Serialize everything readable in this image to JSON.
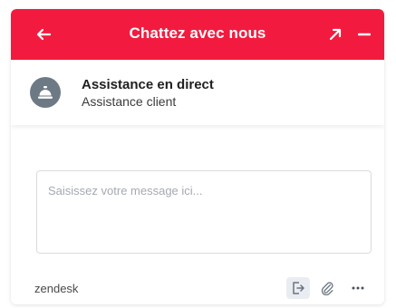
{
  "header": {
    "title": "Chattez avec nous",
    "back_icon": "arrow-left-icon",
    "popout_icon": "arrow-up-right-icon",
    "minimize_icon": "minus-icon",
    "background_color": "#f21b3f"
  },
  "agent": {
    "name": "Assistance en direct",
    "role": "Assistance client",
    "avatar_icon": "service-bell-icon"
  },
  "composer": {
    "placeholder": "Saisissez votre message ici...",
    "value": ""
  },
  "footer": {
    "brand": "zendesk",
    "end_chat_icon": "end-chat-icon",
    "attach_icon": "paperclip-icon",
    "more_icon": "more-horizontal-icon"
  }
}
